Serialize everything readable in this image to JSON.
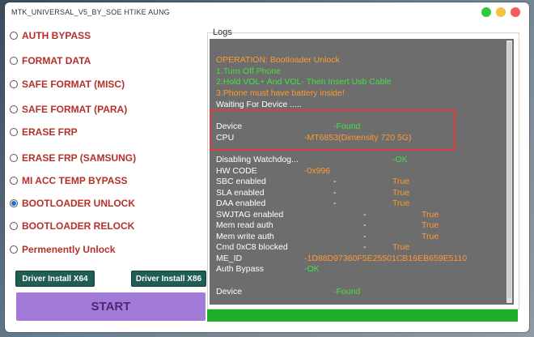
{
  "window": {
    "title": "MTK_UNIVERSAL_V5_BY_SOE HTIKE AUNG"
  },
  "colors": {
    "option_label": "#b5302a",
    "orange": "#ff9a2e",
    "green": "#44e044",
    "start": "#a27ad8",
    "driver_btn": "#1f5f53"
  },
  "options": [
    {
      "label": "AUTH BYPASS",
      "selected": false
    },
    {
      "label": "FORMAT DATA",
      "selected": false
    },
    {
      "label": "SAFE FORMAT (MISC)",
      "selected": false
    },
    {
      "label": "SAFE FORMAT (PARA)",
      "selected": false
    },
    {
      "label": "ERASE FRP",
      "selected": false
    },
    {
      "label": "ERASE FRP (SAMSUNG)",
      "selected": false
    },
    {
      "label": "MI ACC TEMP BYPASS",
      "selected": false
    },
    {
      "label": "BOOTLOADER UNLOCK",
      "selected": true
    },
    {
      "label": "BOOTLOADER RELOCK",
      "selected": false
    },
    {
      "label": "Permenently Unlock",
      "selected": false
    }
  ],
  "buttons": {
    "driver_x64": "Driver Install X64",
    "driver_x86": "Driver Install X86",
    "start": "START"
  },
  "logs": {
    "label": "Logs",
    "operation": "OPERATION: Bootloader Unlock",
    "step1": "1.Turn Off Phone",
    "step2": "2.Hold VOL+ And VOL- Then Insert Usb Cable",
    "step3": "3.Phone must have battery inside!",
    "waiting": " Waiting For Device .....",
    "device_key": "Device",
    "device_val": "-Found",
    "cpu_key": "CPU",
    "cpu_val": "-MT6853(Dimensity 720 5G)",
    "wd_key": "Disabling Watchdog...",
    "wd_val": "-OK",
    "hw_key": "HW CODE",
    "hw_val": "-0x996",
    "sbc_key": "SBC enabled",
    "sbc_dash": "-",
    "sbc_val": "True",
    "sla_key": "SLA enabled",
    "sla_dash": "-",
    "sla_val": "True",
    "daa_key": "DAA enabled",
    "daa_dash": "-",
    "daa_val": "True",
    "swj_key": "SWJTAG enabled",
    "swj_dash": "-",
    "swj_val": "True",
    "mra_key": "Mem read auth",
    "mra_dash": "-",
    "mra_val": "True",
    "mwa_key": "Mem write auth",
    "mwa_dash": "-",
    "mwa_val": "True",
    "cmd_key": "Cmd 0xC8 blocked",
    "cmd_dash": "-",
    "cmd_val": "True",
    "meid_key": "ME_ID",
    "meid_val": "-1D88D97360F5E25501CB16EB659E5110",
    "ab_key": "Auth Bypass",
    "ab_val": "-OK",
    "dev2_key": "Device",
    "dev2_val": "-Found"
  },
  "progress": {
    "fraction": 1.0
  }
}
